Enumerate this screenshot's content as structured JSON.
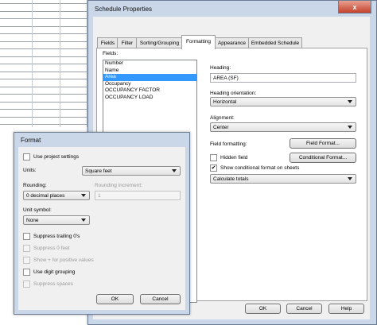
{
  "schedule_properties": {
    "title": "Schedule Properties",
    "tabs": [
      {
        "label": "Fields"
      },
      {
        "label": "Filter"
      },
      {
        "label": "Sorting/Grouping"
      },
      {
        "label": "Formatting"
      },
      {
        "label": "Appearance"
      },
      {
        "label": "Embedded Schedule"
      }
    ],
    "active_tab": "Formatting",
    "fields_label": "Fields:",
    "fields": [
      "Number",
      "Name",
      "Area",
      "Occupancy",
      "OCCUPANCY FACTOR",
      "OCCUPANCY LOAD"
    ],
    "selected_field": "Area",
    "heading_label": "Heading:",
    "heading_value": "AREA (SF)",
    "heading_orientation_label": "Heading orientation:",
    "heading_orientation_value": "Horizontal",
    "alignment_label": "Alignment:",
    "alignment_value": "Center",
    "field_formatting_label": "Field formatting:",
    "field_format_button": "Field Format...",
    "hidden_field_label": "Hidden field",
    "conditional_format_button": "Conditional Format...",
    "show_conditional_label": "Show conditional format on sheets",
    "show_conditional_checked": true,
    "calculate_value": "Calculate totals",
    "ok": "OK",
    "cancel": "Cancel",
    "help": "Help",
    "close_glyph": "x"
  },
  "format_dialog": {
    "title": "Format",
    "use_project_settings": "Use project settings",
    "units_label": "Units:",
    "units_value": "Square feet",
    "rounding_label": "Rounding:",
    "rounding_value": "0 decimal places",
    "rounding_increment_label": "Rounding increment:",
    "rounding_increment_value": "1",
    "unit_symbol_label": "Unit symbol:",
    "unit_symbol_value": "None",
    "suppress_trailing": "Suppress trailing 0's",
    "suppress_zero_feet": "Suppress 0 feet",
    "show_plus": "Show + for positive values",
    "use_digit_grouping": "Use digit grouping",
    "suppress_spaces": "Suppress spaces",
    "ok": "OK",
    "cancel": "Cancel"
  }
}
